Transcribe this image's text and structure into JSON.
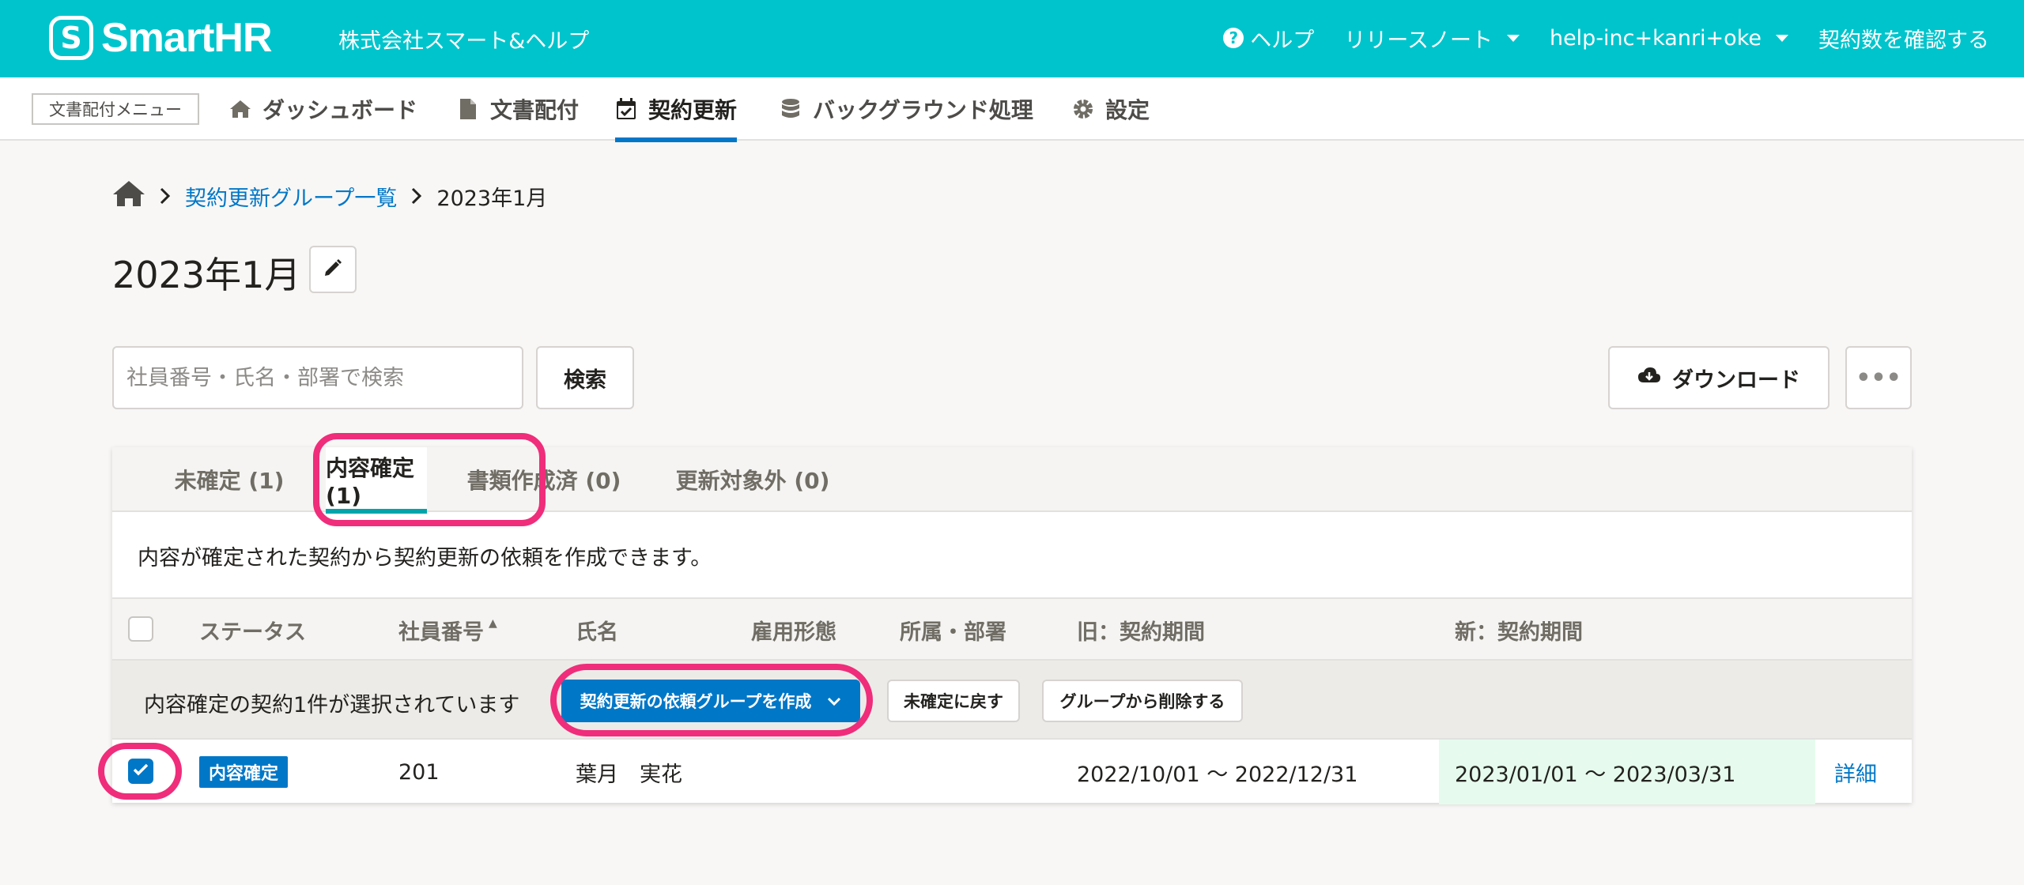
{
  "header": {
    "logo_mark": "S",
    "logo_text": "SmartHR",
    "company": "株式会社スマート&ヘルプ",
    "help_label": "ヘルプ",
    "release_notes_label": "リリースノート",
    "account_label": "help-inc+kanri+oke",
    "contract_count_label": "契約数を確認する"
  },
  "nav": {
    "menu_label": "文書配付メニュー",
    "items": [
      {
        "label": "ダッシュボード",
        "icon": "home-icon"
      },
      {
        "label": "文書配付",
        "icon": "document-icon"
      },
      {
        "label": "契約更新",
        "icon": "calendar-check-icon",
        "active": true
      },
      {
        "label": "バックグラウンド処理",
        "icon": "database-icon"
      },
      {
        "label": "設定",
        "icon": "gear-icon"
      }
    ]
  },
  "breadcrumb": {
    "link_label": "契約更新グループ一覧",
    "current": "2023年1月"
  },
  "page": {
    "title": "2023年1月"
  },
  "search": {
    "placeholder": "社員番号・氏名・部署で検索",
    "button_label": "検索"
  },
  "actions": {
    "download_label": "ダウンロード",
    "more_label": "•••"
  },
  "tabs": [
    {
      "label": "未確定 (1)"
    },
    {
      "label": "内容確定 (1)",
      "active": true
    },
    {
      "label": "書類作成済 (0)"
    },
    {
      "label": "更新対象外 (0)"
    }
  ],
  "description": "内容が確定された契約から契約更新の依頼を作成できます。",
  "table": {
    "columns": [
      "ステータス",
      "社員番号",
      "氏名",
      "雇用形態",
      "所属・部署",
      "旧：契約期間",
      "新：契約期間"
    ],
    "sort_indicator": "▲",
    "bulk": {
      "selected_text": "内容確定の契約1件が選択されています",
      "create_group_label": "契約更新の依頼グループを作成",
      "revert_label": "未確定に戻す",
      "remove_label": "グループから削除する"
    },
    "rows": [
      {
        "status": "内容確定",
        "employee_no": "201",
        "name": "葉月　実花",
        "employment_type": "",
        "department": "",
        "old_period": "2022/10/01 〜 2022/12/31",
        "new_period": "2023/01/01 〜 2023/03/31",
        "detail_label": "詳細"
      }
    ]
  },
  "colors": {
    "header_bg": "#00c4cc",
    "primary": "#0077c7",
    "highlight": "#ef2d7a",
    "new_period_bg": "#e6fbed"
  }
}
